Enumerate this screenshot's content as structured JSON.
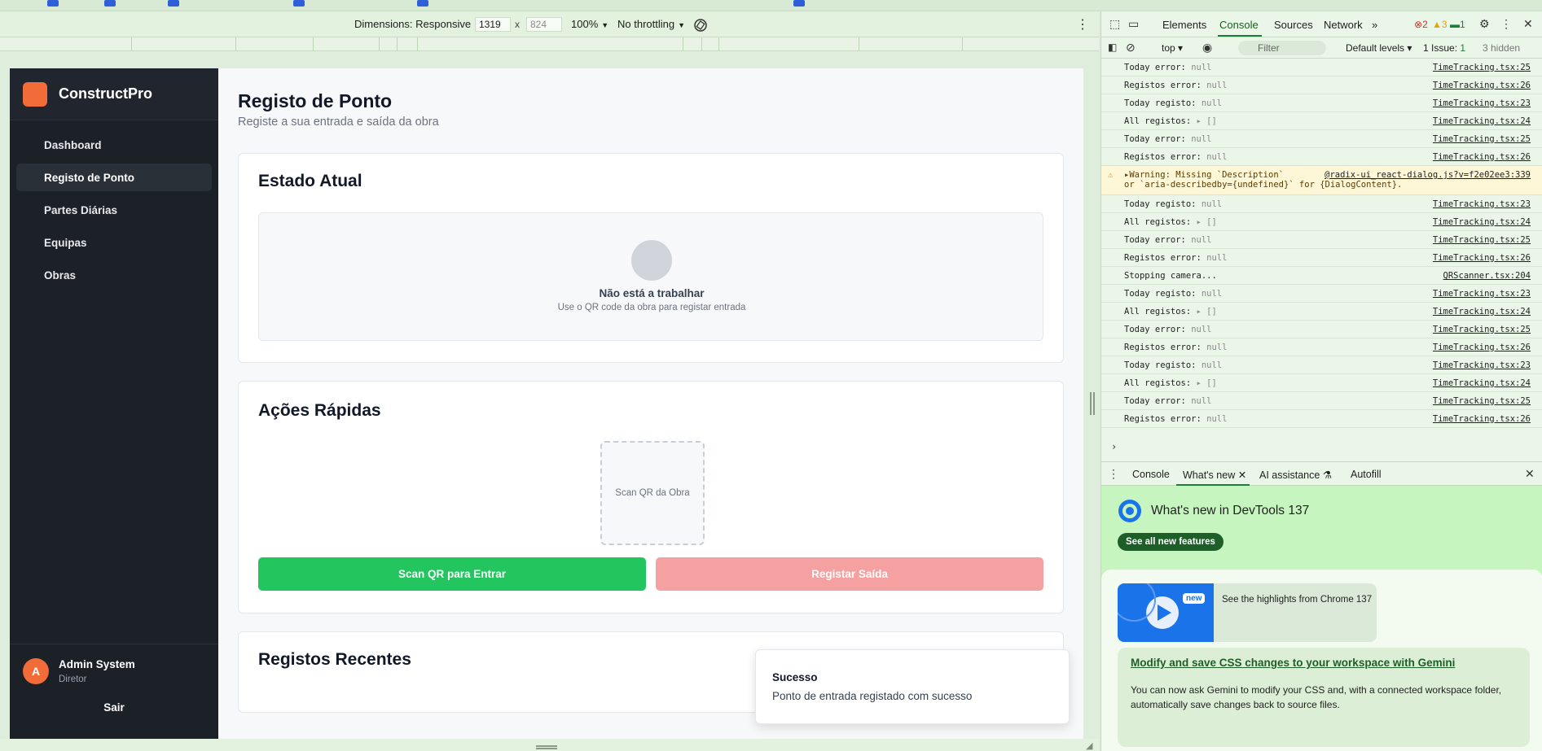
{
  "device_toolbar": {
    "dimensions_label": "Dimensions: Responsive",
    "width": "1319",
    "height": "824",
    "times": "x",
    "zoom": "100%",
    "throttling": "No throttling"
  },
  "app": {
    "brand": "ConstructPro",
    "nav": [
      {
        "label": "Dashboard",
        "active": false
      },
      {
        "label": "Registo de Ponto",
        "active": true
      },
      {
        "label": "Partes Diárias",
        "active": false
      },
      {
        "label": "Equipas",
        "active": false
      },
      {
        "label": "Obras",
        "active": false
      }
    ],
    "user": {
      "initial": "A",
      "name": "Admin System",
      "role": "Diretor"
    },
    "logout": "Sair",
    "page_title": "Registo de Ponto",
    "page_subtitle": "Registe a sua entrada e saída da obra",
    "status_card": {
      "title": "Estado Atual",
      "status": "Não está a trabalhar",
      "hint": "Use o QR code da obra para registar entrada"
    },
    "actions_card": {
      "title": "Ações Rápidas",
      "qr_label": "Scan QR da Obra",
      "enter_button": "Scan QR para Entrar",
      "exit_button": "Registar Saída"
    },
    "recent_card": {
      "title": "Registos Recentes"
    },
    "toast": {
      "title": "Sucesso",
      "message": "Ponto de entrada registado com sucesso"
    }
  },
  "devtools": {
    "tabs": [
      "Elements",
      "Console",
      "Sources",
      "Network"
    ],
    "active_tab": "Console",
    "errors": "2",
    "warnings": "3",
    "messages": "1",
    "context": "top",
    "filter_placeholder": "Filter",
    "levels": "Default levels",
    "issues": "1 Issue:",
    "issue_count": "1",
    "hidden": "3 hidden",
    "logs": [
      {
        "label": "Today error:",
        "value": "null",
        "src": "TimeTracking.tsx:25"
      },
      {
        "label": "Registos error:",
        "value": "null",
        "src": "TimeTracking.tsx:26"
      },
      {
        "label": "Today registo:",
        "value": "null",
        "src": "TimeTracking.tsx:23"
      },
      {
        "label": "All registos:",
        "value": "▸ []",
        "src": "TimeTracking.tsx:24"
      },
      {
        "label": "Today error:",
        "value": "null",
        "src": "TimeTracking.tsx:25"
      },
      {
        "label": "Registos error:",
        "value": "null",
        "src": "TimeTracking.tsx:26"
      },
      {
        "label": "▸Warning: Missing `Description` ",
        "value": "",
        "src": "@radix-ui_react-dialog.js?v=f2e02ee3:339",
        "warn": true,
        "line2": "or `aria-describedby={undefined}` for {DialogContent}."
      },
      {
        "label": "Today registo:",
        "value": "null",
        "src": "TimeTracking.tsx:23"
      },
      {
        "label": "All registos:",
        "value": "▸ []",
        "src": "TimeTracking.tsx:24"
      },
      {
        "label": "Today error:",
        "value": "null",
        "src": "TimeTracking.tsx:25"
      },
      {
        "label": "Registos error:",
        "value": "null",
        "src": "TimeTracking.tsx:26"
      },
      {
        "label": "Stopping camera...",
        "value": "",
        "src": "QRScanner.tsx:204"
      },
      {
        "label": "Today registo:",
        "value": "null",
        "src": "TimeTracking.tsx:23"
      },
      {
        "label": "All registos:",
        "value": "▸ []",
        "src": "TimeTracking.tsx:24"
      },
      {
        "label": "Today error:",
        "value": "null",
        "src": "TimeTracking.tsx:25"
      },
      {
        "label": "Registos error:",
        "value": "null",
        "src": "TimeTracking.tsx:26"
      },
      {
        "label": "Today registo:",
        "value": "null",
        "src": "TimeTracking.tsx:23"
      },
      {
        "label": "All registos:",
        "value": "▸ []",
        "src": "TimeTracking.tsx:24"
      },
      {
        "label": "Today error:",
        "value": "null",
        "src": "TimeTracking.tsx:25"
      },
      {
        "label": "Registos error:",
        "value": "null",
        "src": "TimeTracking.tsx:26"
      }
    ],
    "drawer_tabs": [
      "Console",
      "What's new",
      "AI assistance",
      "Autofill"
    ],
    "whats_new": {
      "title": "What's new in DevTools 137",
      "button": "See all new features",
      "new_badge": "new",
      "highlight": "See the highlights from Chrome 137",
      "feature_title": "Modify and save CSS changes to your workspace with Gemini",
      "feature_body": "You can now ask Gemini to modify your CSS and, with a connected workspace folder, automatically save changes back to source files."
    }
  }
}
